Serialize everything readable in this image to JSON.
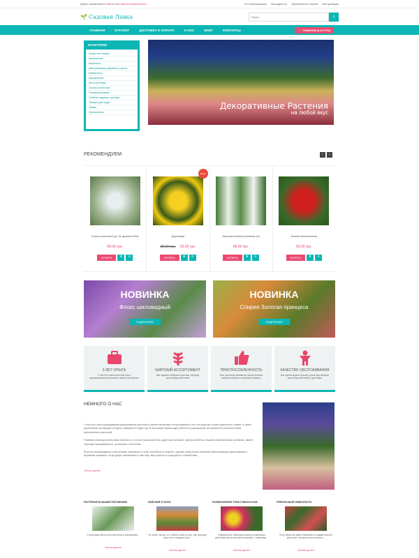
{
  "topbar": {
    "welcome": "Добро пожаловать!",
    "login": "Войти",
    "or": "или",
    "register": "зарегистрироваться",
    "links": [
      "Кто информация",
      "Закладки (0)",
      "Оформление заказа",
      "Авторизация"
    ]
  },
  "header": {
    "logo": "Садовая Лавка",
    "search_placeholder": "Поиск"
  },
  "nav": {
    "items": [
      "ГЛАВНАЯ",
      "КАТАЛОГ",
      "ДОСТАВКА И ОПЛАТА",
      "О НАС",
      "БЛОГ",
      "КОНТАКТЫ"
    ],
    "cart": "ТОВАРОВ (0.00 ГРН)"
  },
  "categories": {
    "title": "КАТЕГОРИИ",
    "items": [
      "Акции на товары",
      "Ампельные",
      "Бархатцы",
      "Декоративные деревья и кусты",
      "Клематисы",
      "Луковичные",
      "Многолетники",
      "Газоны отличные",
      "Почвопокровные",
      "Семена садовых культур",
      "Товары для сада",
      "Травы",
      "Хризантемы"
    ]
  },
  "hero": {
    "title": "Декоративные Растения",
    "subtitle": "на любой вкус"
  },
  "recommend": {
    "title": "РЕКОМЕНДУЕМ",
    "prev": "‹",
    "next": "›"
  },
  "products": [
    {
      "name": "Спирея японская 6 до 7м, диаметр 60см",
      "price": "68.00 грн.",
      "old": "",
      "sale": false
    },
    {
      "name": "Дороникум",
      "price": "26.00 грн.",
      "old": "28.00 грн.",
      "sale": true
    },
    {
      "name": "Вероника белый (колтайлер 5л)",
      "price": "68.00 грн.",
      "old": "",
      "sale": false
    },
    {
      "name": "Калина обыкновенная",
      "price": "55.00 грн.",
      "old": "",
      "sale": false
    }
  ],
  "buy_label": "КУПИТЬ",
  "sale_label": "SALE",
  "banners": [
    {
      "badge": "НОВИНКА",
      "subtitle": "Флокс шиловидный",
      "button": "ПОДРОБНЕЕ"
    },
    {
      "badge": "НОВИНКА",
      "subtitle": "Спирея Золотая принцеса",
      "button": "ПОДРОБНЕЕ"
    }
  ],
  "features": [
    {
      "title": "6 ЛЕТ ОПЫТА",
      "desc": "У нас есть многолетний опыт выращивания растений в своем питомнике"
    },
    {
      "title": "ШИРОКИЙ АССОРТИМЕНТ",
      "desc": "Мы годами собирали для вас лучшую коллекцию растений"
    },
    {
      "title": "ПРИСПОСОБЛЕННОСТЬ",
      "desc": "Все растения являются экологически приспособлены к нашему климату"
    },
    {
      "title": "КАЧЕСТВО ОБСЛУЖИВАНИЯ",
      "desc": "Мы гарантируем лучшее цены при выборе качества растений и доставки"
    }
  ],
  "about": {
    "title": "НЕМНОГО О НАС",
    "p1": "У нас есть опыт выращивания декоративных растений в своем питомнике на протяжении 6 лет, которым мы хотим поделиться с вами. А также растениями, коллекцию которых собирали не один год. В настоящее время идет работа по расширению ассортимента многолетников, вечнозеленых растений.",
    "p2": "Главным своим достоинством считаем то, что все наши растения, даже экзотические, приспособлены к нашим климатическим условиям, имеют хорошую приживаемость, устойчивы к болезням.",
    "p3": "Если вы неравнодушны к растениям, чувствуете в себе потребность творить, сделать свой уголок обитания благоухающим разнотравьем и игривыми красками, тогда добро пожаловать в наш мир, мир красоты и природного спокойствия.",
    "more": "Читать далее"
  },
  "news": [
    {
      "title": "РАСТЕНИЯ В НАШЕМ ПИТОМНИКЕ",
      "desc": "С приходом весны все растения в рассаднике...",
      "more": "Читать далее"
    },
    {
      "title": "РАЙСКИЙ УГОЛОК",
      "desc": "Не знаю, как вы, а я люблю свой уголок, где природа еще спит и каждое утро...",
      "more": "Читать далее"
    },
    {
      "title": "РАЗМНОЖЕНИЕ ТРАВ ГИБИСКУСОВ",
      "desc": "Травянистые гибискусы можно размножать делением куста или вегетативным. Семенами...",
      "more": "Читать далее"
    },
    {
      "title": "ПРЕКРАСНЫЙ ЖИМОЛОСТЬ",
      "desc": "Хочу обратить ваше внимание на удивительное растение, которое нельзя путать...",
      "more": "Читать далее"
    }
  ]
}
